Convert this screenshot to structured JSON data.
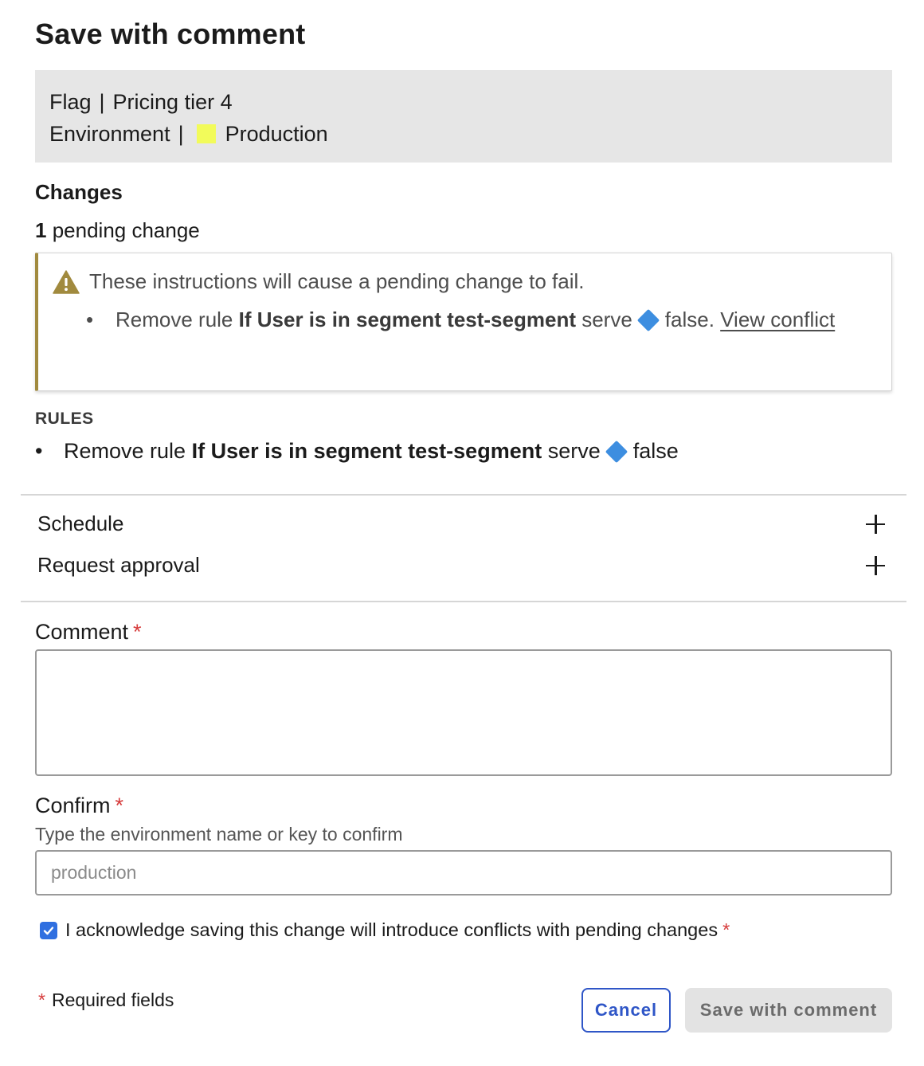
{
  "dialog": {
    "title": "Save with comment"
  },
  "context": {
    "flag_label": "Flag",
    "flag_name": "Pricing tier 4",
    "env_label": "Environment",
    "env_name": "Production",
    "env_color": "#f2fb5a",
    "separator": "|"
  },
  "changes": {
    "heading": "Changes",
    "pending_count": "1",
    "pending_text": "pending change"
  },
  "warning": {
    "icon": "warning-triangle-icon",
    "message": "These instructions will cause a pending change to fail.",
    "item_prefix": "Remove rule",
    "item_rule": "If User is in segment test-segment",
    "item_serve": "serve",
    "item_variation": "false.",
    "link": "View conflict",
    "accent_color": "#a18a3e"
  },
  "rules": {
    "heading": "RULES",
    "item_prefix": "Remove rule",
    "item_rule": "If User is in segment test-segment",
    "item_serve": "serve",
    "item_variation": "false",
    "variation_color": "#3d8ee0"
  },
  "expanders": {
    "schedule": "Schedule",
    "request_approval": "Request approval"
  },
  "comment": {
    "label": "Comment",
    "required_mark": "*",
    "value": ""
  },
  "confirm": {
    "label": "Confirm",
    "required_mark": "*",
    "hint": "Type the environment name or key to confirm",
    "placeholder": "production",
    "value": ""
  },
  "acknowledge": {
    "label": "I acknowledge saving this change will introduce conflicts with pending changes",
    "required_mark": "*",
    "checked": true
  },
  "footer": {
    "required_mark": "*",
    "required_note": "Required fields",
    "cancel_label": "Cancel",
    "save_label": "Save with comment"
  }
}
